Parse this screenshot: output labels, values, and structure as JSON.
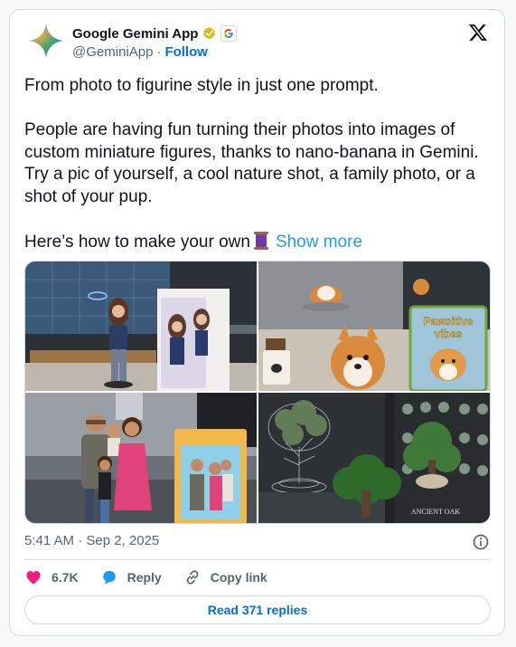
{
  "author": {
    "display_name": "Google Gemini App",
    "handle": "@GeminiApp",
    "separator": "·",
    "follow_label": "Follow",
    "verified_badge_color": "#e2b719"
  },
  "tweet": {
    "lines": [
      "From photo to figurine style in just one prompt.",
      "People are having fun turning their photos into images of custom miniature figures, thanks to nano-banana in Gemini. Try a pic of yourself, a cool nature shot, a family photo, or a shot of your pup."
    ],
    "last_line": "Here’s how to make your own",
    "show_more": "Show more",
    "emoji": "thread-spool-icon"
  },
  "media": {
    "tiles": [
      {
        "id": "figurine-woman"
      },
      {
        "id": "figurine-corgi",
        "box_title": "Pawsitive vibes"
      },
      {
        "id": "figurine-family"
      },
      {
        "id": "figurine-tree",
        "box_caption": "ANCIENT OAK"
      }
    ]
  },
  "meta": {
    "timestamp": "5:41 AM · Sep 2, 2025"
  },
  "actions": {
    "likes": "6.7K",
    "reply_label": "Reply",
    "copy_link_label": "Copy link",
    "like_color": "#f91880",
    "reply_color": "#1d9bf0"
  },
  "read_replies": "Read 371 replies"
}
